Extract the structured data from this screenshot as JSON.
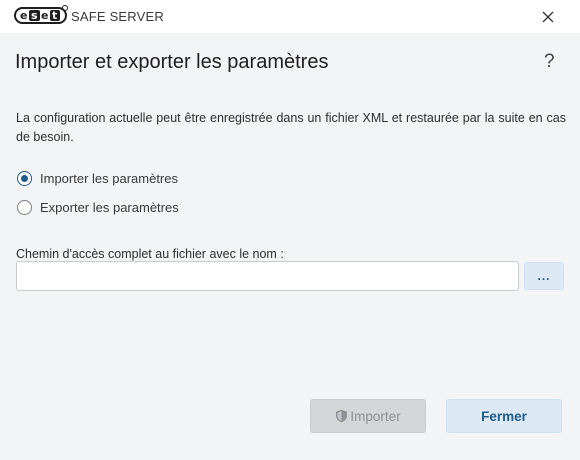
{
  "window": {
    "brand": "eset",
    "app_name": "SAFE SERVER"
  },
  "dialog": {
    "title": "Importer et exporter les paramètres",
    "help_label": "?",
    "description": "La configuration actuelle peut être enregistrée dans un fichier XML et restaurée par la suite en cas de besoin.",
    "options": [
      {
        "label": "Importer les paramètres",
        "selected": true
      },
      {
        "label": "Exporter les paramètres",
        "selected": false
      }
    ],
    "path_label": "Chemin d'accès complet au fichier avec le nom :",
    "path_value": "",
    "browse_label": "...",
    "import_button": "Importer",
    "import_enabled": false,
    "close_button": "Fermer"
  },
  "colors": {
    "accent": "#1f5a8c",
    "button_bg": "#dce9f5",
    "panel_bg": "#f3f4f6",
    "disabled_bg": "#d4d5d7"
  }
}
